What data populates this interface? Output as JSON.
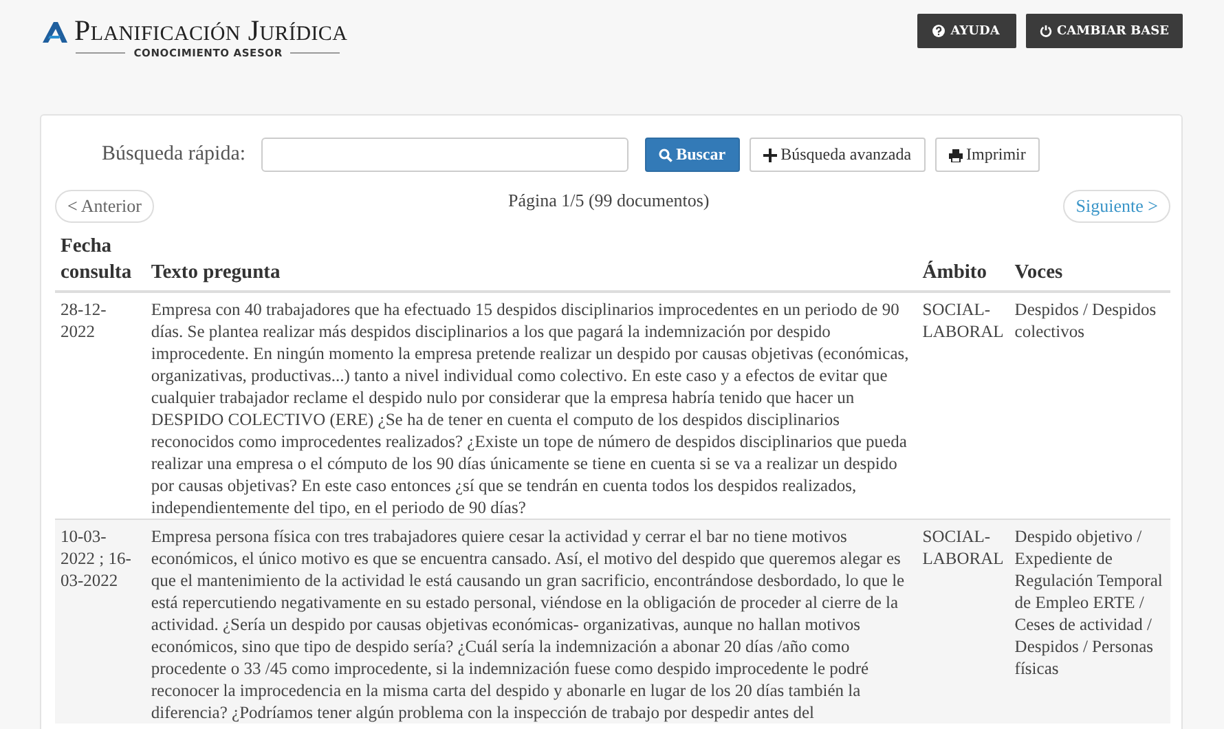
{
  "header": {
    "logo_title": "Planificación Jurídica",
    "logo_subtitle": "CONOCIMIENTO ASESOR",
    "buttons": [
      {
        "kind": "help",
        "label": "AYUDA"
      },
      {
        "kind": "power",
        "label": "CAMBIAR BASE"
      }
    ]
  },
  "search": {
    "label": "Búsqueda rápida:",
    "buttons": [
      {
        "kind": "search",
        "label": "Buscar"
      },
      {
        "kind": "plus",
        "label": "Búsqueda avanzada"
      },
      {
        "kind": "print",
        "label": "Imprimir"
      }
    ]
  },
  "pagination": {
    "previous": "< Anterior",
    "info": "Página 1/5 (99 documentos)",
    "next": "Siguiente >"
  },
  "table": {
    "columns": [
      {
        "line1": "Fecha",
        "line2": "consulta"
      },
      {
        "line2": "Texto pregunta"
      },
      {
        "line2": "Ámbito"
      },
      {
        "line2": "Voces"
      }
    ],
    "rows": [
      {
        "date": "28-12-2022",
        "text": "Empresa con 40 trabajadores que ha efectuado 15 despidos disciplinarios improcedentes en un periodo de 90 días. Se plantea realizar más despidos disciplinarios a los que pagará la indemnización por despido improcedente. En ningún momento la empresa pretende realizar un despido por causas objetivas (económicas, organizativas, productivas...) tanto a nivel individual como colectivo. En este caso y a efectos de evitar que cualquier trabajador reclame el despido nulo por considerar que la empresa habría tenido que hacer un DESPIDO COLECTIVO (ERE) ¿Se ha de tener en cuenta el computo de los despidos disciplinarios reconocidos como improcedentes realizados? ¿Existe un tope de número de despidos disciplinarios que pueda realizar una empresa o el cómputo de los 90 días únicamente se tiene en cuenta si se va a realizar un despido por causas objetivas? En este caso entonces ¿sí que se tendrán en cuenta todos los despidos realizados, independientemente del tipo, en el periodo de 90 días?",
        "scope": "SOCIAL-LABORAL",
        "tags": "Despidos / Despidos colectivos"
      },
      {
        "date": "10-03-2022 ; 16-03-2022",
        "text": "Empresa persona física con tres trabajadores quiere cesar la actividad y cerrar el bar no tiene motivos económicos, el único motivo es que se encuentra cansado. Así, el motivo del despido que queremos alegar es que el mantenimiento de la actividad le está causando un gran sacrificio, encontrándose desbordado, lo que le está repercutiendo negativamente en su estado personal, viéndose en la obligación de proceder al cierre de la actividad. ¿Sería un despido por causas objetivas económicas- organizativas, aunque no hallan motivos económicos, sino que tipo de despido sería? ¿Cuál sería la indemnización a abonar 20 días /año como procedente o 33 /45 como improcedente, si la indemnización fuese como despido improcedente le podré reconocer la improcedencia en la misma carta del despido y abonarle en lugar de los 20 días también la diferencia? ¿Podríamos tener algún problema con la inspección de trabajo por despedir antes del",
        "scope": "SOCIAL-LABORAL",
        "tags": "Despido objetivo / Expediente de Regulación Temporal de Empleo ERTE / Ceses de actividad / Despidos / Personas físicas"
      }
    ]
  }
}
